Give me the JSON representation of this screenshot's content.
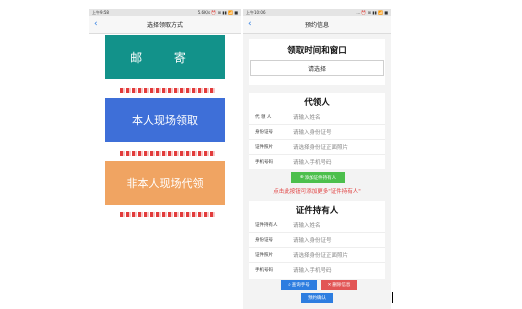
{
  "left_screen": {
    "status_left": "上午9:58",
    "status_right": "5.6K/s ⏰ ⊞ ▮▮ 📶 ■",
    "title": "选择领取方式",
    "options": [
      {
        "label": "邮 寄"
      },
      {
        "label": "本人现场领取"
      },
      {
        "label": "非本人现场代领"
      }
    ]
  },
  "right_screen": {
    "status_left": "上午10:06",
    "status_right": "... ⏰ ⊞ ▮▮ 📶 ■",
    "title": "预约信息",
    "pickup_title": "领取时间和窗口",
    "pickup_select": "请选择",
    "agent_title": "代领人",
    "agent_fields": [
      {
        "label": "代 领 人",
        "placeholder": "请输入姓名"
      },
      {
        "label": "身份证号",
        "placeholder": "请输入身份证号"
      },
      {
        "label": "证件照片",
        "placeholder": "请选择身份证正面照片"
      },
      {
        "label": "手机号码",
        "placeholder": "请输入手机号码"
      }
    ],
    "add_button": "添加证件持有人",
    "hint": "点击此按钮可添加更多\"证件持有人\"",
    "holder_title": "证件持有人",
    "holder_fields": [
      {
        "label": "证件持有人",
        "placeholder": "请输入姓名"
      },
      {
        "label": "身份证号",
        "placeholder": "请输入身份证号"
      },
      {
        "label": "证件照片",
        "placeholder": "请选择身份证正面照片"
      },
      {
        "label": "手机号码",
        "placeholder": "请输入手机号码"
      }
    ],
    "query_button": "查询手号",
    "delete_button": "删除信息",
    "confirm_button": "预约确认"
  },
  "colors": {
    "mail": "#12928a",
    "self": "#3e6fd8",
    "proxy": "#f0a462",
    "add": "#4cbf4c",
    "hint": "#e03c3c",
    "query": "#2d7de0",
    "delete": "#e25555",
    "confirm": "#2d7de0"
  }
}
